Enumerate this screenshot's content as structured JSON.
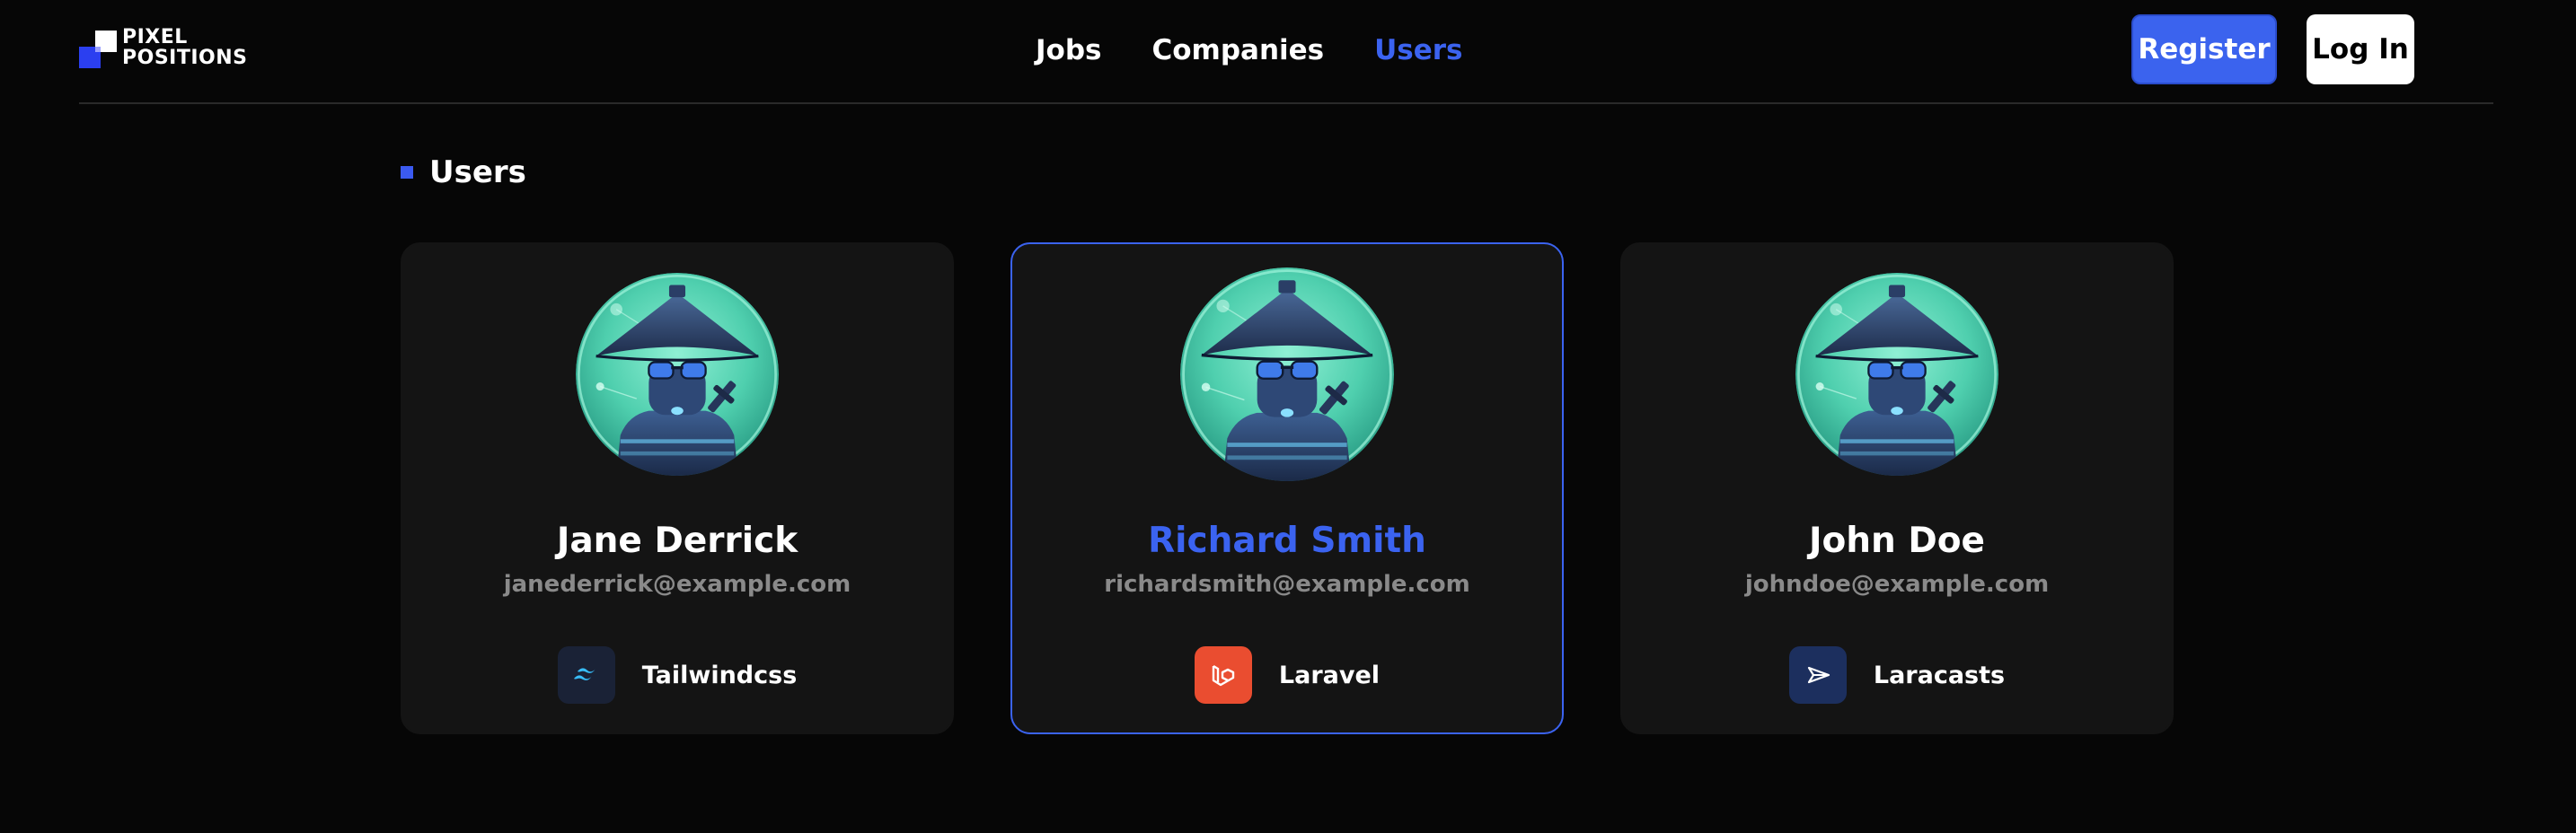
{
  "brand": {
    "line1": "Pixel",
    "line2": "Positions"
  },
  "nav": {
    "jobs": "Jobs",
    "companies": "Companies",
    "users": "Users",
    "active": "Users"
  },
  "auth": {
    "register": "Register",
    "login": "Log In"
  },
  "section": {
    "title": "Users"
  },
  "colors": {
    "accent": "#3b63f0",
    "background": "#060606",
    "card": "#141414"
  },
  "users": [
    {
      "name": "Jane Derrick",
      "email": "janederrick@example.com",
      "company": "Tailwindcss",
      "company_icon": "tailwind-icon",
      "highlighted": false
    },
    {
      "name": "Richard Smith",
      "email": "richardsmith@example.com",
      "company": "Laravel",
      "company_icon": "laravel-icon",
      "highlighted": true
    },
    {
      "name": "John Doe",
      "email": "johndoe@example.com",
      "company": "Laracasts",
      "company_icon": "laracasts-icon",
      "highlighted": false
    }
  ]
}
